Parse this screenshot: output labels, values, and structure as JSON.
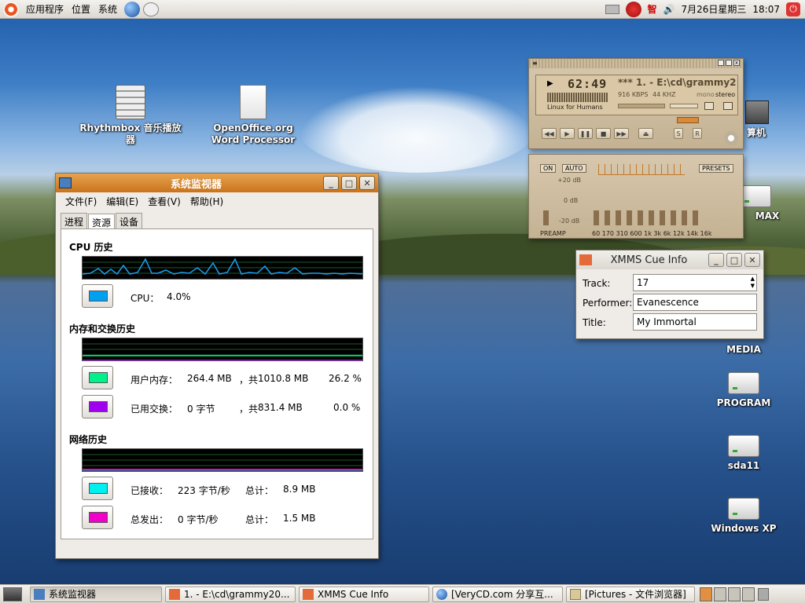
{
  "top_panel": {
    "menus": [
      "应用程序",
      "位置",
      "系统"
    ],
    "clock_date": "7月26日星期三",
    "clock_time": "18:07",
    "ime": "智"
  },
  "desktop_icons": [
    {
      "label": "Rhythmbox 音乐播放器",
      "icon": "music-player-icon"
    },
    {
      "label": "OpenOffice.org Word Processor",
      "icon": "document-icon"
    },
    {
      "label": "算机",
      "icon": "computer-icon"
    },
    {
      "label": "MAX",
      "icon": "drive-icon"
    },
    {
      "label": "MEDIA",
      "icon": "drive-icon"
    },
    {
      "label": "PROGRAM",
      "icon": "drive-icon"
    },
    {
      "label": "sda11",
      "icon": "drive-icon"
    },
    {
      "label": "Windows XP",
      "icon": "drive-icon"
    }
  ],
  "sysmon": {
    "title": "系统监视器",
    "menu": [
      "文件(F)",
      "编辑(E)",
      "查看(V)",
      "帮助(H)"
    ],
    "tabs": [
      "进程",
      "资源",
      "设备"
    ],
    "active_tab": "资源",
    "cpu": {
      "heading": "CPU 历史",
      "label": "CPU：",
      "value": "4.0%",
      "color": "#00a0f0"
    },
    "mem": {
      "heading": "内存和交换历史",
      "user_label": "用户内存：",
      "user_value": "264.4 MB",
      "user_total_label": "，共",
      "user_total": "1010.8 MB",
      "user_pct": "26.2 %",
      "user_color": "#00f08a",
      "swap_label": "已用交换：",
      "swap_value": "0 字节",
      "swap_total_label": "，共",
      "swap_total": "831.4 MB",
      "swap_pct": "0.0 %",
      "swap_color": "#a000f0"
    },
    "net": {
      "heading": "网络历史",
      "recv_label": "已接收：",
      "recv_value": "223 字节/秒",
      "recv_total_label": "总计：",
      "recv_total": "8.9 MB",
      "recv_color": "#00f0f0",
      "sent_label": "总发出：",
      "sent_value": "0 字节/秒",
      "sent_total_label": "总计：",
      "sent_total": "1.5 MB",
      "sent_color": "#f000c8"
    }
  },
  "xmms": {
    "time": "62:49",
    "track": "*** 1. - E:\\cd\\grammy2",
    "kbps": "916 KBPS",
    "khz": "44 KHZ",
    "mono": "mono",
    "stereo": "stereo",
    "vis_text": "Linux for Humans",
    "eq": {
      "on": "ON",
      "auto": "AUTO",
      "presets": "PRESETS",
      "plus20": "+20 dB",
      "zero": "0 dB",
      "minus20": "-20 dB",
      "preamp": "PREAMP",
      "freqs": "60 170 310 600 1k 3k 6k 12k 14k 16k",
      "levels": [
        0.5,
        0.5,
        0.5,
        0.5,
        0.5,
        0.5,
        0.5,
        0.5,
        0.5,
        0.5,
        0.5
      ]
    }
  },
  "cue": {
    "title": "XMMS Cue Info",
    "track_label": "Track:",
    "track": "17",
    "performer_label": "Performer:",
    "performer": "Evanescence",
    "title_label": "Title:",
    "title_value": "My Immortal"
  },
  "taskbar": [
    "系统监视器",
    "1. - E:\\cd\\grammy20...",
    "XMMS Cue Info",
    "[VeryCD.com 分享互...",
    "[Pictures - 文件浏览器]"
  ]
}
